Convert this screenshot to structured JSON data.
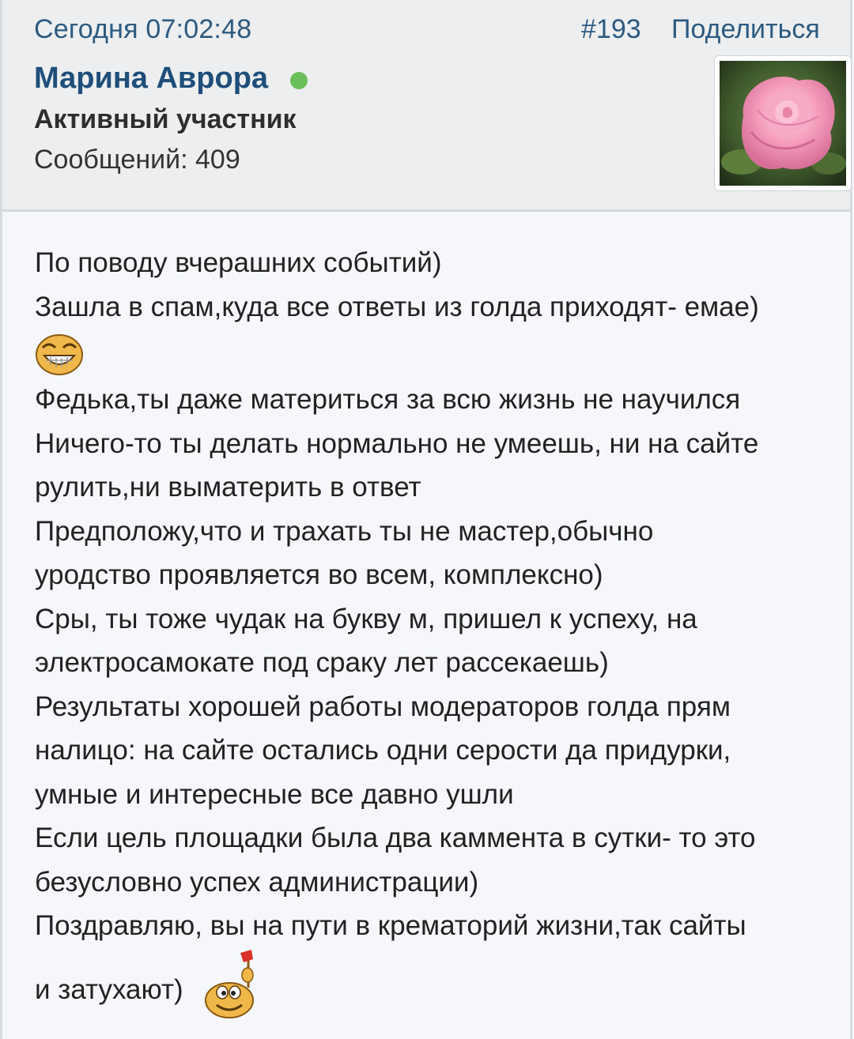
{
  "post": {
    "date": "Сегодня 07:02:48",
    "number": "#193",
    "share_label": "Поделиться"
  },
  "author": {
    "name": "Марина Аврора",
    "role": "Активный участник",
    "messages_label": "Сообщений:",
    "messages_count": "409",
    "avatar_icon": "rose-avatar-icon",
    "online_color": "#6bbf5a"
  },
  "body": {
    "lines": [
      "По поводу вчерашних событий)",
      "Зашла в спам,куда все ответы из голда приходят- емае)",
      "Федька,ты даже материться за всю жизнь не научился",
      "Ничего-то ты делать нормально не умеешь, ни на сайте",
      "рулить,ни выматерить в ответ",
      "Предположу,что и трахать ты не мастер,обычно",
      "уродство проявляется во всем, комплексно)",
      "Сры, ты тоже чудак на букву м, пришел к успеху, на",
      "электросамокате под сраку лет рассекаешь)",
      "Результаты хорошей работы модераторов голда прям",
      "налицо: на сайте остались одни серости да придурки,",
      "умные и интересные все давно ушли",
      "Если цель площадки была два каммента в сутки- то это",
      "безусловно успех администрации)",
      "Поздравляю, вы на пути в крематорий жизни,так сайты",
      "и затухают)"
    ],
    "smiley1_icon": "grin-smiley-icon",
    "smiley2_icon": "flag-smiley-icon"
  },
  "colors": {
    "link": "#2d5a80",
    "username": "#1f4e79",
    "header_bg": "#eceeef",
    "body_bg": "#f5f7fa"
  }
}
